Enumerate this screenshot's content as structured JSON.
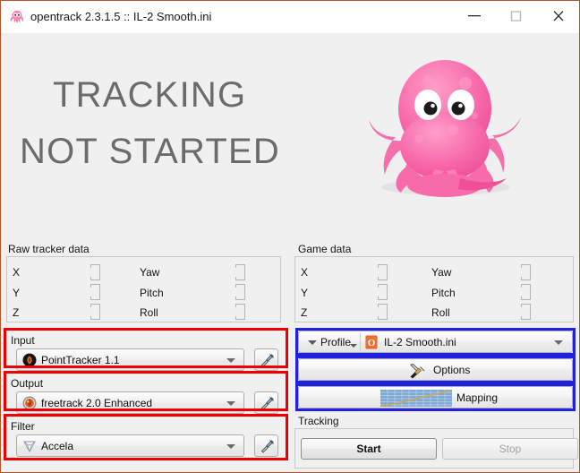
{
  "window": {
    "title": "opentrack 2.3.1.5 :: IL-2 Smooth.ini",
    "icon": "octopus-icon",
    "controls": {
      "minimize": "minimize-icon",
      "maximize": "maximize-icon",
      "close": "close-icon"
    },
    "border_color": "#b6512c"
  },
  "hero": {
    "line1": "TRACKING",
    "line2": "NOT STARTED",
    "logo": "octopus-logo",
    "text_color": "#6b6b6b"
  },
  "raw_tracker_data": {
    "title": "Raw tracker data",
    "left_labels": [
      "X",
      "Y",
      "Z"
    ],
    "right_labels": [
      "Yaw",
      "Pitch",
      "Roll"
    ],
    "left_values": [
      "",
      "",
      ""
    ],
    "right_values": [
      "",
      "",
      ""
    ]
  },
  "game_data": {
    "title": "Game data",
    "left_labels": [
      "X",
      "Y",
      "Z"
    ],
    "right_labels": [
      "Yaw",
      "Pitch",
      "Roll"
    ],
    "left_values": [
      "",
      "",
      ""
    ],
    "right_values": [
      "",
      "",
      ""
    ]
  },
  "input": {
    "title": "Input",
    "value": "PointTracker 1.1",
    "icon": "pointtracker-icon",
    "settings_icon": "hammer-icon"
  },
  "output": {
    "title": "Output",
    "value": "freetrack 2.0 Enhanced",
    "icon": "freetrack-icon",
    "settings_icon": "hammer-icon"
  },
  "filter": {
    "title": "Filter",
    "value": "Accela",
    "icon": "accela-diamond-icon",
    "settings_icon": "hammer-icon"
  },
  "profile": {
    "label": "Profile",
    "file_name": "IL-2 Smooth.ini",
    "file_icon": "ini-file-icon",
    "menu_icon": "chevron-down-icon",
    "dropdown_icon": "chevron-down-icon"
  },
  "options": {
    "label": "Options",
    "icon": "tools-icon"
  },
  "mapping": {
    "label": "Mapping",
    "icon": "curve-chart-icon"
  },
  "tracking": {
    "title": "Tracking",
    "start_label": "Start",
    "stop_label": "Stop",
    "stop_disabled": true
  },
  "annotations": {
    "red_color": "#ee0000",
    "blue_color": "#2020e0",
    "red_boxes": [
      "input-group",
      "output-group",
      "filter-group"
    ],
    "blue_boxes": [
      "profile-button",
      "options-button",
      "mapping-button"
    ]
  }
}
